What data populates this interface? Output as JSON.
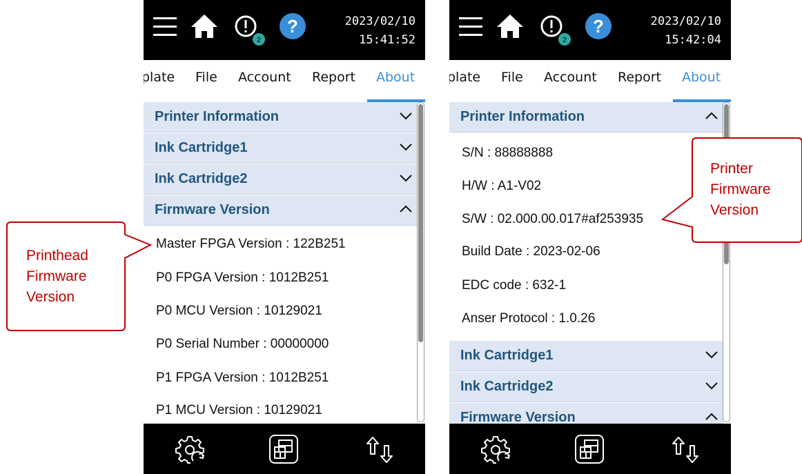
{
  "left_screen": {
    "date": "2023/02/10",
    "time": "15:41:52",
    "alert_badge": "2",
    "tabs": [
      "plate",
      "File",
      "Account",
      "Report",
      "About"
    ],
    "sections": [
      {
        "title": "Printer Information",
        "state": "collapsed"
      },
      {
        "title": "Ink Cartridge1",
        "state": "collapsed"
      },
      {
        "title": "Ink Cartridge2",
        "state": "collapsed"
      },
      {
        "title": "Firmware Version",
        "state": "expanded"
      }
    ],
    "firmware_rows": [
      "Master FPGA Version : 122B251",
      "P0 FPGA Version : 1012B251",
      "P0 MCU Version : 10129021",
      "P0 Serial Number : 00000000",
      "P1 FPGA Version : 1012B251",
      "P1 MCU Version : 10129021"
    ]
  },
  "right_screen": {
    "date": "2023/02/10",
    "time": "15:42:04",
    "alert_badge": "2",
    "tabs": [
      "plate",
      "File",
      "Account",
      "Report",
      "About"
    ],
    "sections": [
      {
        "title": "Printer Information",
        "state": "expanded"
      },
      {
        "title": "Ink Cartridge1",
        "state": "collapsed"
      },
      {
        "title": "Ink Cartridge2",
        "state": "collapsed"
      },
      {
        "title": "Firmware Version",
        "state": "expanded"
      }
    ],
    "printer_rows": [
      "S/N : 88888888",
      "H/W : A1-V02",
      "S/W : 02.000.00.017#af253935",
      "Build Date : 2023-02-06",
      "EDC code : 632-1",
      "Anser Protocol : 1.0.26"
    ]
  },
  "callouts": {
    "printhead": [
      "Printhead",
      "Firmware",
      "Version"
    ],
    "printer": [
      "Printer",
      "Firmware",
      "Version"
    ]
  },
  "icons": [
    "menu-icon",
    "home-icon",
    "alert-icon",
    "help-icon",
    "settings-refresh-icon",
    "layout-icon",
    "sort-arrows-icon"
  ],
  "colors": {
    "accent": "#3a8fd8",
    "section_bg": "#dde6f2",
    "section_text": "#22567f",
    "callout": "#c00000",
    "bar_bg": "#000000",
    "badge": "#2fa8a0"
  }
}
